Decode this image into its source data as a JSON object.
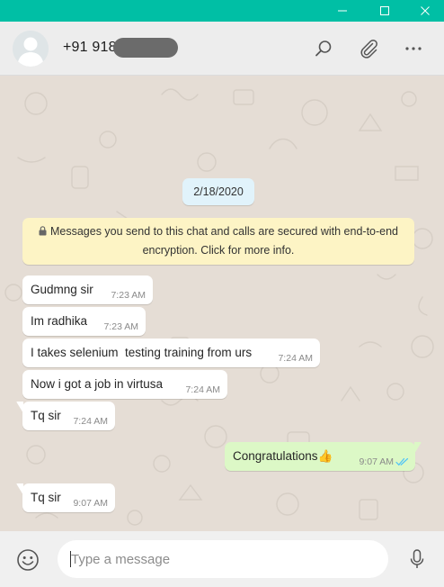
{
  "window": {
    "controls": [
      "minimize-icon",
      "maximize-icon",
      "close-icon"
    ],
    "accent_color": "#00bfa5"
  },
  "header": {
    "contact_name": "+91 918",
    "icons": [
      "search-icon",
      "paperclip-icon",
      "more-options-icon"
    ]
  },
  "chat": {
    "date": "2/18/2020",
    "encryption_notice": "Messages you send to this chat and calls are secured with end-to-end encryption. Click for more info.",
    "messages": [
      {
        "direction": "in",
        "text": "Gudmng sir",
        "time": "7:23 AM"
      },
      {
        "direction": "in",
        "text": "Im radhika",
        "time": "7:23 AM"
      },
      {
        "direction": "in",
        "text": "I takes selenium  testing training from urs",
        "time": "7:24 AM"
      },
      {
        "direction": "in",
        "text": "Now i got a job in virtusa",
        "time": "7:24 AM"
      },
      {
        "direction": "in",
        "text": "Tq sir",
        "time": "7:24 AM"
      },
      {
        "direction": "out",
        "text": "Congratulations👍",
        "time": "9:07 AM",
        "status": "read"
      },
      {
        "direction": "in",
        "text": "Tq sir",
        "time": "9:07 AM"
      }
    ]
  },
  "composer": {
    "placeholder": "Type a message",
    "value": "",
    "icons": [
      "emoji-icon",
      "microphone-icon"
    ]
  },
  "colors": {
    "chat_background": "#e5ddd5",
    "incoming_bubble": "#ffffff",
    "outgoing_bubble": "#dcf8c6",
    "date_chip": "#e1f3fb",
    "notice": "#fdf4c5",
    "read_ticks": "#4fc3f7"
  }
}
